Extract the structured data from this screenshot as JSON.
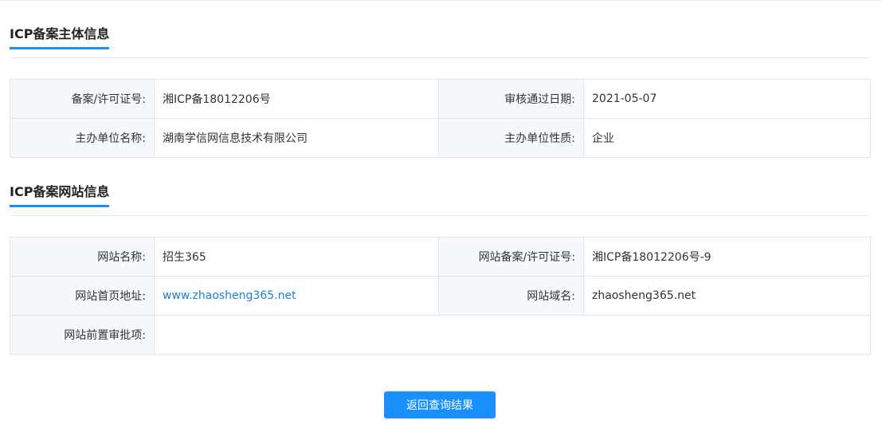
{
  "entity_section": {
    "title": "ICP备案主体信息",
    "rows": [
      {
        "label1": "备案/许可证号:",
        "value1": "湘ICP备18012206号",
        "label2": "审核通过日期:",
        "value2": "2021-05-07"
      },
      {
        "label1": "主办单位名称:",
        "value1": "湖南学信网信息技术有限公司",
        "label2": "主办单位性质:",
        "value2": "企业"
      }
    ]
  },
  "website_section": {
    "title": "ICP备案网站信息",
    "site_name_label": "网站名称:",
    "site_name": "招生365",
    "site_license_label": "网站备案/许可证号:",
    "site_license": "湘ICP备18012206号-9",
    "homepage_label": "网站首页地址:",
    "homepage": "www.zhaosheng365.net",
    "domain_label": "网站域名:",
    "domain": "zhaosheng365.net",
    "preapproval_label": "网站前置审批项:",
    "preapproval": ""
  },
  "actions": {
    "back_label": "返回查询结果"
  },
  "colors": {
    "accent": "#1890ff",
    "link": "#1a80e0",
    "label_bg": "#f5f9fd",
    "border": "#dde5ee"
  }
}
